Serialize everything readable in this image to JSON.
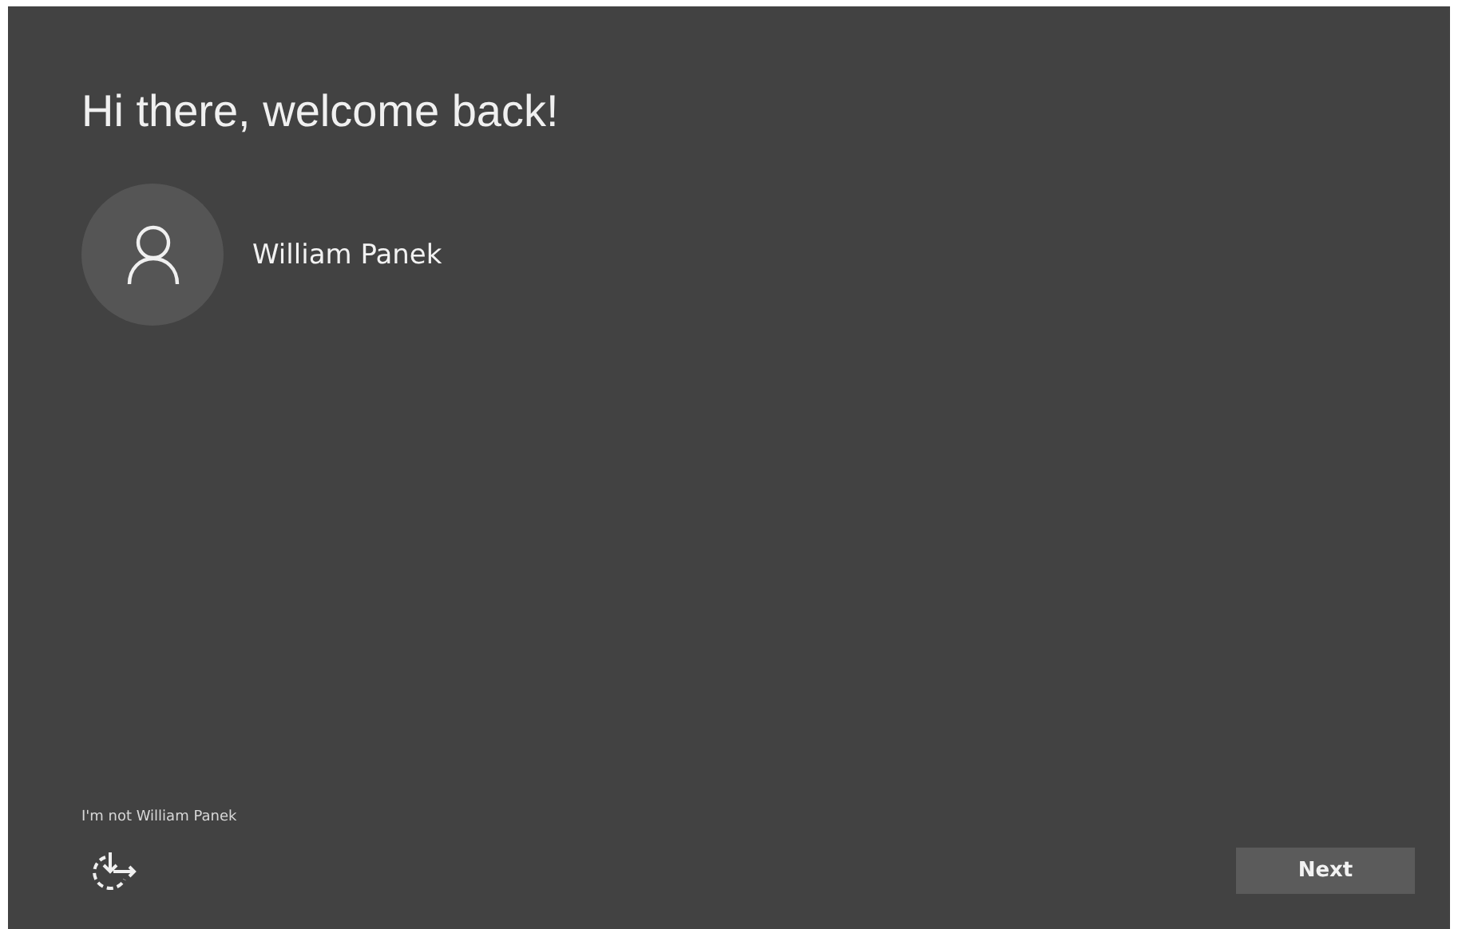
{
  "title": "Hi there, welcome back!",
  "user": {
    "name": "William Panek"
  },
  "not_me_link": "I'm not William Panek",
  "buttons": [
    {
      "label": "Next"
    }
  ]
}
